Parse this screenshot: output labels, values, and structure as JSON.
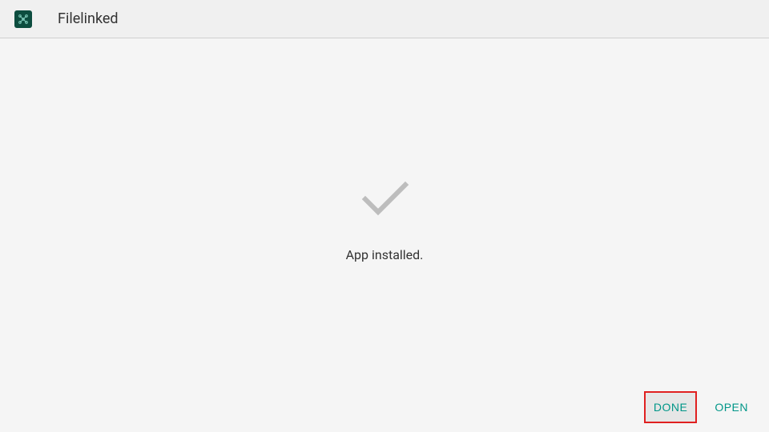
{
  "header": {
    "app_title": "Filelinked"
  },
  "main": {
    "status_text": "App installed."
  },
  "buttons": {
    "done_label": "DONE",
    "open_label": "OPEN"
  },
  "colors": {
    "accent": "#009688",
    "highlight_border": "#e02020"
  }
}
